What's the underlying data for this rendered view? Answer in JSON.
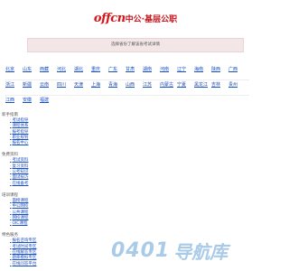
{
  "header": {
    "logo_latin": "offcn",
    "logo_cn": "中公·基层公职"
  },
  "notice": {
    "text": "选择省份了解该省考试详情"
  },
  "provinces": [
    [
      "北京",
      "山东",
      "西藏",
      "河北",
      "湖北",
      "重庆",
      "广东",
      "甘肃",
      "湖南",
      "河南",
      "辽宁",
      "海南",
      "陕西",
      "广西"
    ],
    [
      "浙江",
      "新疆",
      "云南",
      "四川",
      "天津",
      "上海",
      "青海",
      "山西",
      "江苏",
      "内蒙古",
      "宁夏",
      "黑龙江",
      "吉林",
      "贵州"
    ],
    [
      "江西",
      "安徽",
      "福建"
    ]
  ],
  "sections": [
    {
      "title": "新手指南",
      "links": [
        "考试指导",
        "课程体系",
        "报考指导",
        "职业规划",
        "报名中心"
      ]
    },
    {
      "title": "免费资料",
      "links": [
        "考试资料",
        "复习资料",
        "公考知识",
        "面试技巧",
        "在线备考"
      ]
    },
    {
      "title": "培训课程",
      "links": [
        "面授课程",
        "中公网校",
        "公共课程",
        "网校课程",
        "OIC课程"
      ]
    },
    {
      "title": "特色服务",
      "links": [
        "报名咨询专区",
        "考试时间专区",
        "在线解答专区",
        "题库模拟专区",
        "在线问答平台"
      ]
    }
  ],
  "watermark": {
    "digits": "0401",
    "text": "导航库"
  }
}
